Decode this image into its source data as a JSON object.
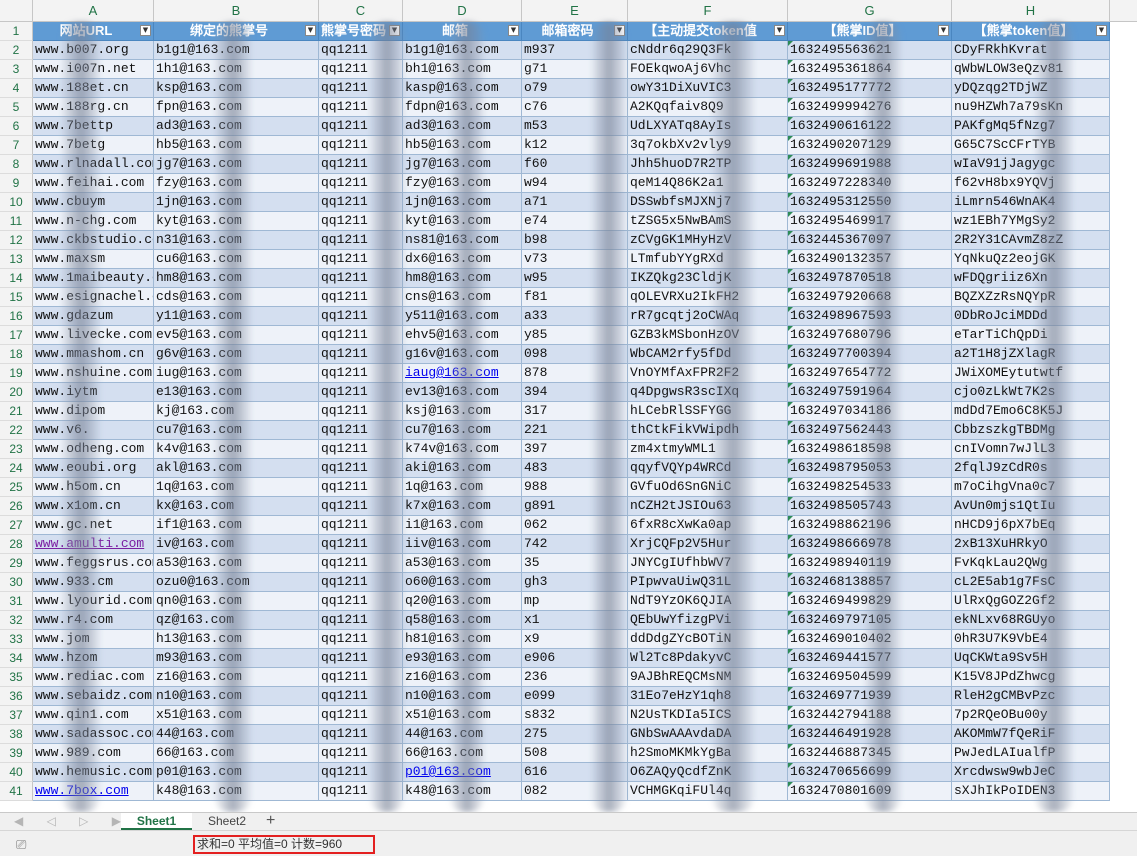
{
  "columns": [
    "A",
    "B",
    "C",
    "D",
    "E",
    "F",
    "G",
    "H"
  ],
  "headers": [
    "网站URL",
    "绑定的熊掌号",
    "熊掌号密码",
    "邮箱",
    "邮箱密码",
    "【主动提交token值",
    "【熊掌ID值】",
    "【熊掌token值】"
  ],
  "filter_glyph": "▼",
  "rows": [
    [
      "www.b007.org",
      "b1g1@163.com",
      "qq1211",
      "b1g1@163.com",
      "m937",
      "cNddr6q29Q3Fk",
      "1632495563621",
      "CDyFRkhKvrat"
    ],
    [
      "www.i007n.net",
      "1h1@163.com",
      "qq1211",
      "bh1@163.com",
      "g71",
      "FOEkqwoAj6Vhc",
      "1632495361864",
      "qWbWLOW3eQzv81"
    ],
    [
      "www.188et.cn",
      "ksp@163.com",
      "qq1211",
      "kasp@163.com",
      "o79",
      "owY31DiXuVIC3",
      "1632495177772",
      "yDQzqg2TDjWZ"
    ],
    [
      "www.188rg.cn",
      "fpn@163.com",
      "qq1211",
      "fdpn@163.com",
      "c76",
      "A2KQqfaiv8Q9",
      "1632499994276",
      "nu9HZWh7a79sKn"
    ],
    [
      "www.7bettp",
      "ad3@163.com",
      "qq1211",
      "ad3@163.com",
      "m53",
      "UdLXYATq8AyIs",
      "1632490616122",
      "PAKfgMq5fNzg7"
    ],
    [
      "www.7betg",
      "hb5@163.com",
      "qq1211",
      "hb5@163.com",
      "k12",
      "3q7okbXv2vly9",
      "1632490207129",
      "G65C7ScCFrTYB"
    ],
    [
      "www.rlnadall.com",
      "jg7@163.com",
      "qq1211",
      "jg7@163.com",
      "f60",
      "Jhh5huoD7R2TP",
      "1632499691988",
      "wIaV91jJagygc"
    ],
    [
      "www.feihai.com",
      "fzy@163.com",
      "qq1211",
      "fzy@163.com",
      "w94",
      "qeM14Q86K2a1",
      "1632497228340",
      "f62vH8bx9YQVj"
    ],
    [
      "www.cbuym",
      "1jn@163.com",
      "qq1211",
      "1jn@163.com",
      "a71",
      "DSSwbfsMJXNj7",
      "1632495312550",
      "iLmrn546WnAK4"
    ],
    [
      "www.n-chg.com",
      "kyt@163.com",
      "qq1211",
      "kyt@163.com",
      "e74",
      "tZSG5x5NwBAmS",
      "1632495469917",
      "wz1EBh7YMgSy2"
    ],
    [
      "www.ckbstudio.com",
      "n31@163.com",
      "qq1211",
      "ns81@163.com",
      "b98",
      "zCVgGK1MHyHzV",
      "1632445367097",
      "2R2Y31CAvmZ8zZ"
    ],
    [
      "www.maxsm",
      "cu6@163.com",
      "qq1211",
      "dx6@163.com",
      "v73",
      "LTmfubYYgRXd",
      "1632490132357",
      "YqNkuQz2eojGK"
    ],
    [
      "www.1maibeauty.com",
      "hm8@163.com",
      "qq1211",
      "hm8@163.com",
      "w95",
      "IKZQkg23CldjK",
      "1632497870518",
      "wFDQgriiz6Xn"
    ],
    [
      "www.esignachel.com",
      "cds@163.com",
      "qq1211",
      "cns@163.com",
      "f81",
      "qOLEVRXu2IkFH2",
      "1632497920668",
      "BQZXZzRsNQYpR"
    ],
    [
      "www.gdazum",
      "y11@163.com",
      "qq1211",
      "y511@163.com",
      "a33",
      "rR7gcqtj2oCWAq",
      "1632498967593",
      "0DbRoJciMDDd"
    ],
    [
      "www.livecke.com",
      "ev5@163.com",
      "qq1211",
      "ehv5@163.com",
      "y85",
      "GZB3kMSbonHzOV",
      "1632497680796",
      "eTarTiChQpDi"
    ],
    [
      "www.mmashom.cn",
      "g6v@163.com",
      "qq1211",
      "g16v@163.com",
      "098",
      "WbCAM2rfy5fDd",
      "1632497700394",
      "a2T1H8jZXlagR"
    ],
    [
      "www.nshuine.com",
      "iug@163.com",
      "qq1211",
      "iaug@163.com",
      "878",
      "VnOYMfAxFPR2F2",
      "1632497654772",
      "JWiXOMEytutwtf"
    ],
    [
      "www.iytm",
      "e13@163.com",
      "qq1211",
      "ev13@163.com",
      "394",
      "q4DpgwsR3scIXq",
      "1632497591964",
      "cjo0zLkWt7K2s"
    ],
    [
      "www.dipom",
      "kj@163.com",
      "qq1211",
      "ksj@163.com",
      "317",
      "hLCebRlSSFYGG",
      "1632497034186",
      "mdDd7Emo6C8K5J"
    ],
    [
      "www.v6.",
      "cu7@163.com",
      "qq1211",
      "cu7@163.com",
      "221",
      "thCtkFikVWipdh",
      "1632497562443",
      "CbbzszkgTBDMg"
    ],
    [
      "www.odheng.com",
      "k4v@163.com",
      "qq1211",
      "k74v@163.com",
      "397",
      "zm4xtmyWML1",
      "1632498618598",
      "cnIVomn7wJlL3"
    ],
    [
      "www.eoubi.org",
      "akl@163.com",
      "qq1211",
      "aki@163.com",
      "483",
      "qqyfVQYp4WRCd",
      "1632498795053",
      "2fqlJ9zCdR0s"
    ],
    [
      "www.h5om.cn",
      "1q@163.com",
      "qq1211",
      "1q@163.com",
      "988",
      "GVfuOd6SnGNiC",
      "1632498254533",
      "m7oCihgVna0c7"
    ],
    [
      "www.x1om.cn",
      "kx@163.com",
      "qq1211",
      "k7x@163.com",
      "g891",
      "nCZH2tJSIOu63",
      "1632498505743",
      "AvUn0mjs1QtIu"
    ],
    [
      "www.gc.net",
      "if1@163.com",
      "qq1211",
      "i1@163.com",
      "062",
      "6fxR8cXwKa0ap",
      "1632498862196",
      "nHCD9j6pX7bEq"
    ],
    [
      "www.amulti.com",
      "iv@163.com",
      "qq1211",
      "iiv@163.com",
      "742",
      "XrjCQFp2V5Hur",
      "1632498666978",
      "2xB13XuHRkyO"
    ],
    [
      "www.feggsrus.com",
      "a53@163.com",
      "qq1211",
      "a53@163.com",
      "35",
      "JNYCgIUfhbWV7",
      "1632498940119",
      "FvKqkLau2QWg"
    ],
    [
      "www.933.cm",
      "ozu0@163.com",
      "qq1211",
      "o60@163.com",
      "gh3",
      "PIpwvaUiwQ31L",
      "1632468138857",
      "cL2E5ab1g7FsC"
    ],
    [
      "www.lyourid.com",
      "qn0@163.com",
      "qq1211",
      "q20@163.com",
      "mp",
      "NdT9YzOK6QJIA",
      "1632469499829",
      "UlRxQgGOZ2Gf2"
    ],
    [
      "www.r4.com",
      "qz@163.com",
      "qq1211",
      "q58@163.com",
      "x1",
      "QEbUwYfizgPVi",
      "1632469797105",
      "ekNLxv68RGUyo"
    ],
    [
      "www.jom",
      "h13@163.com",
      "qq1211",
      "h81@163.com",
      "x9",
      "ddDdgZYcBOTiN",
      "1632469010402",
      "0hR3U7K9VbE4"
    ],
    [
      "www.hzom",
      "m93@163.com",
      "qq1211",
      "e93@163.com",
      "e906",
      "Wl2Tc8PdakyvC",
      "1632469441577",
      "UqCKWta9Sv5H"
    ],
    [
      "www.rediac.com",
      "z16@163.com",
      "qq1211",
      "z16@163.com",
      "236",
      "9AJBhREQCMsNM",
      "1632469504599",
      "K15V8JPdZhwcg"
    ],
    [
      "www.sebaidz.com",
      "n10@163.com",
      "qq1211",
      "n10@163.com",
      "e099",
      "31Eo7eHzY1qh8",
      "1632469771939",
      "RleH2gCMBvPzc"
    ],
    [
      "www.qin1.com",
      "x51@163.com",
      "qq1211",
      "x51@163.com",
      "s832",
      "N2UsTKDIa5ICS",
      "1632442794188",
      "7p2RQeOBu00y"
    ],
    [
      "www.sadassoc.com",
      "44@163.com",
      "qq1211",
      "44@163.com",
      "275",
      "GNbSwAAAvdaDA",
      "1632446491928",
      "AKOMmW7fQeRiF"
    ],
    [
      "www.989.com",
      "66@163.com",
      "qq1211",
      "66@163.com",
      "508",
      "h2SmoMKMkYgBa",
      "1632446887345",
      "PwJedLAIualfP"
    ],
    [
      "www.hemusic.com",
      "p01@163.com",
      "qq1211",
      "p01@163.com",
      "616",
      "O6ZAQyQcdfZnK",
      "1632470656699",
      "Xrcdwsw9wbJeC"
    ],
    [
      "www.7box.com",
      "k48@163.com",
      "qq1211",
      "k48@163.com",
      "082",
      "VCHMGKqiFUl4q",
      "1632470801609",
      "sXJhIkPoIDEN3"
    ]
  ],
  "row_numbers": [
    "1",
    "2",
    "3",
    "4",
    "5",
    "6",
    "7",
    "8",
    "9",
    "10",
    "11",
    "12",
    "13",
    "14",
    "15",
    "16",
    "17",
    "18",
    "19",
    "20",
    "21",
    "22",
    "23",
    "24",
    "25",
    "26",
    "27",
    "28",
    "29",
    "30",
    "31",
    "32",
    "33",
    "34",
    "35",
    "36",
    "37",
    "38",
    "39",
    "40",
    "41"
  ],
  "tabs": {
    "nav_arrows": "◀ ◁ ▷ ▶",
    "sheet1": "Sheet1",
    "sheet2": "Sheet2",
    "add": "+"
  },
  "status": {
    "summary": "求和=0  平均值=0  计数=960",
    "icon": "record-macro-icon"
  }
}
